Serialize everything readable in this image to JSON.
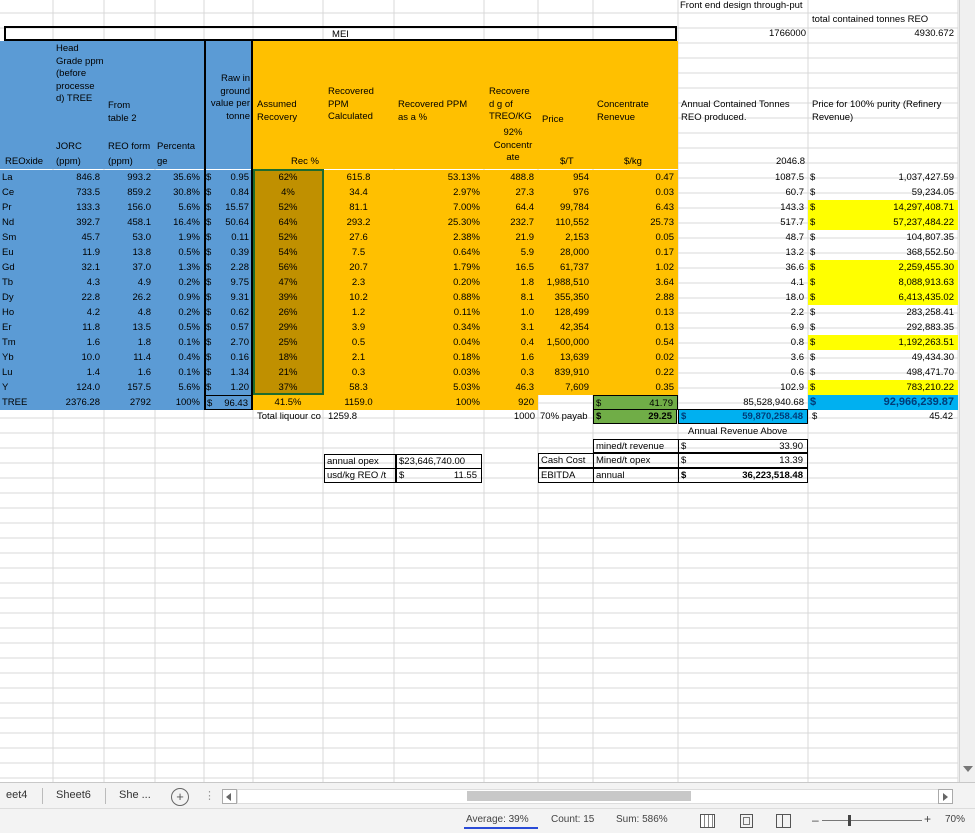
{
  "header": {
    "front_end": "Front end design through-put",
    "total_contained": "total contained tonnes REO",
    "front_end_val": "1766000",
    "total_contained_val": "4930.672",
    "mei": "MEI"
  },
  "col_heads": {
    "head_grade": "Head Grade ppm (before processe d) TREE",
    "from_table": "From table 2",
    "raw_in": "Raw in ground value per tonne",
    "assumed": "Assumed Recovery",
    "rec_ppm": "Recovered PPM Calculated",
    "rec_pct": "Recovered PPM as a %",
    "rec_treo": "Recovere d g of TREO/KG",
    "price": "Price",
    "conc_rev": "Concentrate Renevue",
    "annual": "Annual Contained Tonnes REO produced.",
    "price100": "Price for 100% purity (Refinery Revenue)",
    "jorc": "JORC",
    "reo_form": "REO form",
    "percenta": "Percenta",
    "pct92": "92% Concentr ate",
    "reoxide": "REOxide",
    "ppm1": "(ppm)",
    "ppm2": "(ppm)",
    "ge": "ge",
    "recpct": "Rec %",
    "usd_t": "$/T",
    "usd_kg": "$/kg",
    "annual_head": "2046.8"
  },
  "rows": [
    {
      "el": "La",
      "jorc": "846.8",
      "reo": "993.2",
      "pct": "35.6%",
      "raw": "0.95",
      "rec": "62%",
      "ppm": "615.8",
      "ppmpct": "53.13%",
      "treo": "488.8",
      "price": "954",
      "conc": "0.47",
      "ann": "1087.5",
      "ref": "1,037,427.59",
      "hl": ""
    },
    {
      "el": "Ce",
      "jorc": "733.5",
      "reo": "859.2",
      "pct": "30.8%",
      "raw": "0.84",
      "rec": "4%",
      "ppm": "34.4",
      "ppmpct": "2.97%",
      "treo": "27.3",
      "price": "976",
      "conc": "0.03",
      "ann": "60.7",
      "ref": "59,234.05",
      "hl": ""
    },
    {
      "el": "Pr",
      "jorc": "133.3",
      "reo": "156.0",
      "pct": "5.6%",
      "raw": "15.57",
      "rec": "52%",
      "ppm": "81.1",
      "ppmpct": "7.00%",
      "treo": "64.4",
      "price": "99,784",
      "conc": "6.43",
      "ann": "143.3",
      "ref": "14,297,408.71",
      "hl": "yel"
    },
    {
      "el": "Nd",
      "jorc": "392.7",
      "reo": "458.1",
      "pct": "16.4%",
      "raw": "50.64",
      "rec": "64%",
      "ppm": "293.2",
      "ppmpct": "25.30%",
      "treo": "232.7",
      "price": "110,552",
      "conc": "25.73",
      "ann": "517.7",
      "ref": "57,237,484.22",
      "hl": "yel"
    },
    {
      "el": "Sm",
      "jorc": "45.7",
      "reo": "53.0",
      "pct": "1.9%",
      "raw": "0.11",
      "rec": "52%",
      "ppm": "27.6",
      "ppmpct": "2.38%",
      "treo": "21.9",
      "price": "2,153",
      "conc": "0.05",
      "ann": "48.7",
      "ref": "104,807.35",
      "hl": ""
    },
    {
      "el": "Eu",
      "jorc": "11.9",
      "reo": "13.8",
      "pct": "0.5%",
      "raw": "0.39",
      "rec": "54%",
      "ppm": "7.5",
      "ppmpct": "0.64%",
      "treo": "5.9",
      "price": "28,000",
      "conc": "0.17",
      "ann": "13.2",
      "ref": "368,552.50",
      "hl": ""
    },
    {
      "el": "Gd",
      "jorc": "32.1",
      "reo": "37.0",
      "pct": "1.3%",
      "raw": "2.28",
      "rec": "56%",
      "ppm": "20.7",
      "ppmpct": "1.79%",
      "treo": "16.5",
      "price": "61,737",
      "conc": "1.02",
      "ann": "36.6",
      "ref": "2,259,455.30",
      "hl": "yel"
    },
    {
      "el": "Tb",
      "jorc": "4.3",
      "reo": "4.9",
      "pct": "0.2%",
      "raw": "9.75",
      "rec": "47%",
      "ppm": "2.3",
      "ppmpct": "0.20%",
      "treo": "1.8",
      "price": "1,988,510",
      "conc": "3.64",
      "ann": "4.1",
      "ref": "8,088,913.63",
      "hl": "yel"
    },
    {
      "el": "Dy",
      "jorc": "22.8",
      "reo": "26.2",
      "pct": "0.9%",
      "raw": "9.31",
      "rec": "39%",
      "ppm": "10.2",
      "ppmpct": "0.88%",
      "treo": "8.1",
      "price": "355,350",
      "conc": "2.88",
      "ann": "18.0",
      "ref": "6,413,435.02",
      "hl": "yel"
    },
    {
      "el": "Ho",
      "jorc": "4.2",
      "reo": "4.8",
      "pct": "0.2%",
      "raw": "0.62",
      "rec": "26%",
      "ppm": "1.2",
      "ppmpct": "0.11%",
      "treo": "1.0",
      "price": "128,499",
      "conc": "0.13",
      "ann": "2.2",
      "ref": "283,258.41",
      "hl": ""
    },
    {
      "el": "Er",
      "jorc": "11.8",
      "reo": "13.5",
      "pct": "0.5%",
      "raw": "0.57",
      "rec": "29%",
      "ppm": "3.9",
      "ppmpct": "0.34%",
      "treo": "3.1",
      "price": "42,354",
      "conc": "0.13",
      "ann": "6.9",
      "ref": "292,883.35",
      "hl": ""
    },
    {
      "el": "Tm",
      "jorc": "1.6",
      "reo": "1.8",
      "pct": "0.1%",
      "raw": "2.70",
      "rec": "25%",
      "ppm": "0.5",
      "ppmpct": "0.04%",
      "treo": "0.4",
      "price": "1,500,000",
      "conc": "0.54",
      "ann": "0.8",
      "ref": "1,192,263.51",
      "hl": "yel"
    },
    {
      "el": "Yb",
      "jorc": "10.0",
      "reo": "11.4",
      "pct": "0.4%",
      "raw": "0.16",
      "rec": "18%",
      "ppm": "2.1",
      "ppmpct": "0.18%",
      "treo": "1.6",
      "price": "13,639",
      "conc": "0.02",
      "ann": "3.6",
      "ref": "49,434.30",
      "hl": ""
    },
    {
      "el": "Lu",
      "jorc": "1.4",
      "reo": "1.6",
      "pct": "0.1%",
      "raw": "1.34",
      "rec": "21%",
      "ppm": "0.3",
      "ppmpct": "0.03%",
      "treo": "0.3",
      "price": "839,910",
      "conc": "0.22",
      "ann": "0.6",
      "ref": "498,471.70",
      "hl": ""
    },
    {
      "el": "Y",
      "jorc": "124.0",
      "reo": "157.5",
      "pct": "5.6%",
      "raw": "1.20",
      "rec": "37%",
      "ppm": "58.3",
      "ppmpct": "5.03%",
      "treo": "46.3",
      "price": "7,609",
      "conc": "0.35",
      "ann": "102.9",
      "ref": "783,210.22",
      "hl": "yel"
    }
  ],
  "tree": {
    "el": "TREE",
    "jorc": "2376.28",
    "reo": "2792",
    "pct": "100%",
    "raw": "96.43",
    "rec": "41.5%",
    "ppm": "1159.0",
    "ppmpct": "100%",
    "treo": "920",
    "conc": "41.79",
    "ann": "85,528,940.68",
    "ref": "92,966,239.87"
  },
  "totals": {
    "liquor_label": "Total liquour co",
    "liquor_val": "1259.8",
    "k1000": "1000",
    "pay_label": "70% payab",
    "pay_val": "29.25",
    "rev_val": "59,870,258.48",
    "ratio": "45.42",
    "ann_rev_above": "Annual Revenue Above",
    "mined_rev_label": "mined/t revenue",
    "mined_rev_val": "33.90",
    "mined_opex_label": "Mined/t opex",
    "mined_opex_val": "13.39",
    "cash_cost": "Cash Cost",
    "ebitda": "EBITDA",
    "annual_label": "annual",
    "annual_val": "36,223,518.48",
    "annual_opex_label": "annual opex",
    "annual_opex_val": "$23,646,740.00",
    "usdkg_label": "usd/kg REO /t",
    "usdkg_val": "11.55",
    "dollar": "$"
  },
  "tabs": {
    "t1": "eet4",
    "t2": "Sheet6",
    "t3": "She ...",
    "add": "+"
  },
  "status": {
    "average": "Average: 39%",
    "count": "Count: 15",
    "sum": "Sum: 586%",
    "zoom": "70%"
  }
}
